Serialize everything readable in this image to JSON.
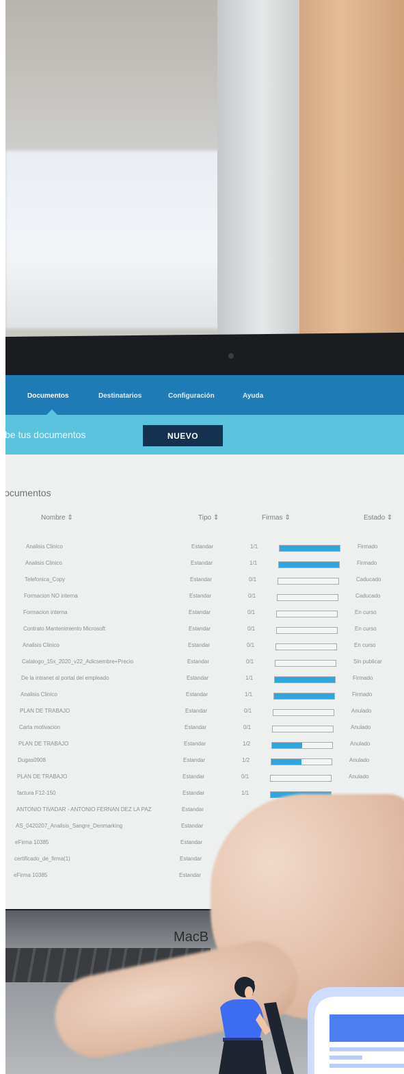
{
  "nav": {
    "items": [
      "Documentos",
      "Destinatarios",
      "Configuración",
      "Ayuda"
    ],
    "active": "Documentos"
  },
  "banner": {
    "text": "Sube tus documentos",
    "button_label": "NUEVO"
  },
  "section_title": "Documentos",
  "table": {
    "headers": [
      "Nombre ⇕",
      "Tipo ⇕",
      "Firmas ⇕",
      "Estado ⇕"
    ],
    "rows": [
      {
        "name": "Analisis Clinico",
        "type": "Estandar",
        "firmas": "1/1",
        "progress": 1.0,
        "status": "Firmado"
      },
      {
        "name": "Analisis Clinico",
        "type": "Estandar",
        "firmas": "1/1",
        "progress": 1.0,
        "status": "Firmado"
      },
      {
        "name": "Telefonica_Copy",
        "type": "Estandar",
        "firmas": "0/1",
        "progress": 0.0,
        "status": "Caducado"
      },
      {
        "name": "Formacion NO interna",
        "type": "Estandar",
        "firmas": "0/1",
        "progress": 0.0,
        "status": "Caducado"
      },
      {
        "name": "Formacion interna",
        "type": "Estandar",
        "firmas": "0/1",
        "progress": 0.0,
        "status": "En curso"
      },
      {
        "name": "Contrato Mantenimiento Microsoft",
        "type": "Estandar",
        "firmas": "0/1",
        "progress": 0.0,
        "status": "En curso"
      },
      {
        "name": "Analisis Clinico",
        "type": "Estandar",
        "firmas": "0/1",
        "progress": 0.0,
        "status": "En curso"
      },
      {
        "name": "Catalogo_15x_2020_v22_Adicsembre+Precio",
        "type": "Estandar",
        "firmas": "0/1",
        "progress": 0.0,
        "status": "Sin publicar"
      },
      {
        "name": "De la intranet al portal del empleado",
        "type": "Estandar",
        "firmas": "1/1",
        "progress": 1.0,
        "status": "Firmado"
      },
      {
        "name": "Analisis Clinico",
        "type": "Estandar",
        "firmas": "1/1",
        "progress": 1.0,
        "status": "Firmado"
      },
      {
        "name": "PLAN DE TRABAJO",
        "type": "Estandar",
        "firmas": "0/1",
        "progress": 0.0,
        "status": "Anulado"
      },
      {
        "name": "Carta motivacion",
        "type": "Estandar",
        "firmas": "0/1",
        "progress": 0.0,
        "status": "Anulado"
      },
      {
        "name": "PLAN DE TRABAJO",
        "type": "Estandar",
        "firmas": "1/2",
        "progress": 0.5,
        "status": "Anulado"
      },
      {
        "name": "Dugas0908",
        "type": "Estandar",
        "firmas": "1/2",
        "progress": 0.5,
        "status": "Anulado"
      },
      {
        "name": "PLAN DE TRABAJO",
        "type": "Estandar",
        "firmas": "0/1",
        "progress": 0.0,
        "status": "Anulado"
      },
      {
        "name": "factura F12-150",
        "type": "Estandar",
        "firmas": "1/1",
        "progress": 1.0,
        "status": ""
      },
      {
        "name": "ANTONIO TIVADAR - ANTONIO FERNAN DEZ LA PAZ",
        "type": "Estandar",
        "firmas": "",
        "progress": null,
        "status": ""
      },
      {
        "name": "AS_0420207_Analisis_Sangre_Denmarking",
        "type": "Estandar",
        "firmas": "",
        "progress": null,
        "status": ""
      },
      {
        "name": "eFirma 10385",
        "type": "Estandar",
        "firmas": "",
        "progress": null,
        "status": ""
      },
      {
        "name": "certificado_de_firma(1)",
        "type": "Estandar",
        "firmas": "",
        "progress": null,
        "status": ""
      },
      {
        "name": "eFirma 10385",
        "type": "Estandar",
        "firmas": "",
        "progress": null,
        "status": ""
      }
    ]
  },
  "laptop_brand": "MacB",
  "colors": {
    "nav": "#1e7bb6",
    "banner": "#5cc3df",
    "button": "#15314f",
    "progress": "#2fa7dc"
  },
  "illustration": {
    "figure_icon": "person-with-pen-icon",
    "document_icon": "document-window-icon"
  }
}
